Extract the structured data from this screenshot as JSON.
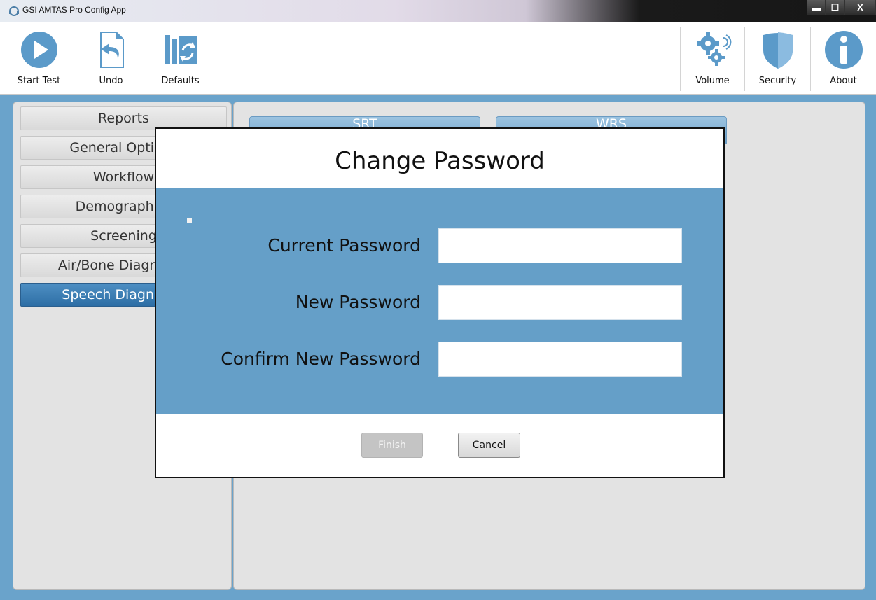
{
  "window": {
    "title": "GSI AMTAS Pro Config App",
    "controls": {
      "minimize": "▬",
      "maximize": "☐",
      "close": "X"
    }
  },
  "toolbar": {
    "left_buttons": [
      {
        "label": "Start Test",
        "icon": "play-icon"
      },
      {
        "label": "Undo",
        "icon": "undo-icon"
      },
      {
        "label": "Defaults",
        "icon": "defaults-icon"
      }
    ],
    "right_buttons": [
      {
        "label": "Volume",
        "icon": "gears-volume-icon"
      },
      {
        "label": "Security",
        "icon": "shield-icon"
      },
      {
        "label": "About",
        "icon": "info-icon"
      }
    ]
  },
  "sidebar": {
    "items": [
      {
        "label": "Reports",
        "active": false
      },
      {
        "label": "General Options",
        "active": false
      },
      {
        "label": "Workflow",
        "active": false
      },
      {
        "label": "Demographics",
        "active": false
      },
      {
        "label": "Screening",
        "active": false
      },
      {
        "label": "Air/Bone Diagnostic",
        "active": false
      },
      {
        "label": "Speech Diagnostic",
        "active": true
      }
    ]
  },
  "main": {
    "tabs": [
      {
        "label": "SRT"
      },
      {
        "label": "WRS"
      }
    ]
  },
  "dialog": {
    "title": "Change Password",
    "fields": [
      {
        "label": "Current Password",
        "value": ""
      },
      {
        "label": "New Password",
        "value": ""
      },
      {
        "label": "Confirm New Password",
        "value": ""
      }
    ],
    "finish_label": "Finish",
    "finish_enabled": false,
    "cancel_label": "Cancel"
  },
  "colors": {
    "accent_blue": "#659fc8",
    "active_nav": "#3a7bb2",
    "icon_blue": "#5b9ac9",
    "panel_gray": "#e3e3e3"
  }
}
